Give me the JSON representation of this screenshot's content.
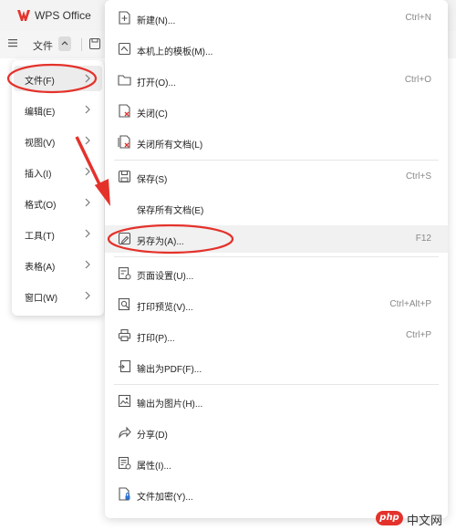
{
  "window": {
    "title": "WPS Office"
  },
  "toolbar": {
    "file_label": "文件"
  },
  "left_menu": {
    "items": [
      {
        "label": "文件(F)"
      },
      {
        "label": "编辑(E)"
      },
      {
        "label": "视图(V)"
      },
      {
        "label": "插入(I)"
      },
      {
        "label": "格式(O)"
      },
      {
        "label": "工具(T)"
      },
      {
        "label": "表格(A)"
      },
      {
        "label": "窗口(W)"
      }
    ]
  },
  "file_menu": {
    "items": [
      {
        "label": "新建(N)...",
        "shortcut": "Ctrl+N",
        "icon": "new-doc-icon"
      },
      {
        "label": "本机上的模板(M)...",
        "shortcut": "",
        "icon": "template-icon"
      },
      {
        "label": "打开(O)...",
        "shortcut": "Ctrl+O",
        "icon": "folder-icon"
      },
      {
        "label": "关闭(C)",
        "shortcut": "",
        "icon": "close-doc-icon"
      },
      {
        "label": "关闭所有文档(L)",
        "shortcut": "",
        "icon": "close-all-icon"
      },
      {
        "label": "保存(S)",
        "shortcut": "Ctrl+S",
        "icon": "save-icon"
      },
      {
        "label": "保存所有文档(E)",
        "shortcut": "",
        "icon": ""
      },
      {
        "label": "另存为(A)...",
        "shortcut": "F12",
        "icon": "save-as-icon"
      },
      {
        "label": "页面设置(U)...",
        "shortcut": "",
        "icon": "page-setup-icon"
      },
      {
        "label": "打印预览(V)...",
        "shortcut": "Ctrl+Alt+P",
        "icon": "print-preview-icon"
      },
      {
        "label": "打印(P)...",
        "shortcut": "Ctrl+P",
        "icon": "printer-icon"
      },
      {
        "label": "输出为PDF(F)...",
        "shortcut": "",
        "icon": "pdf-export-icon"
      },
      {
        "label": "输出为图片(H)...",
        "shortcut": "",
        "icon": "image-export-icon"
      },
      {
        "label": "分享(D)",
        "shortcut": "",
        "icon": "share-icon"
      },
      {
        "label": "属性(I)...",
        "shortcut": "",
        "icon": "properties-icon"
      },
      {
        "label": "文件加密(Y)...",
        "shortcut": "",
        "icon": "encrypt-icon"
      }
    ]
  },
  "watermark": {
    "badge": "php",
    "text": "中文网"
  },
  "colors": {
    "brand": "#e4322b",
    "annotation": "#e4322b",
    "highlight": "#f1f1f1"
  }
}
